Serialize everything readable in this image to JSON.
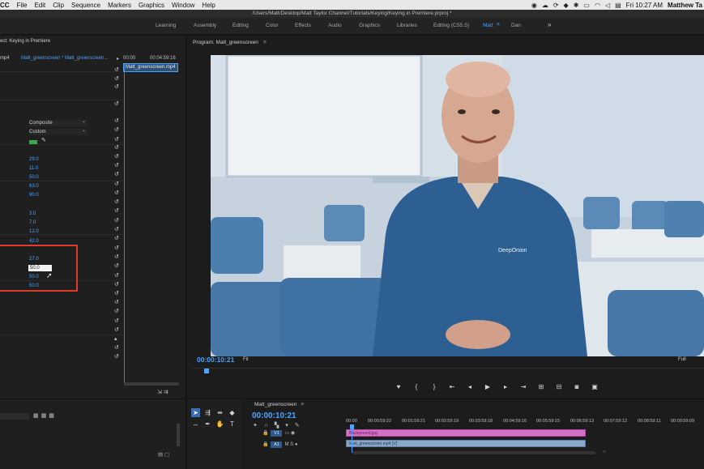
{
  "menubar": {
    "app": "CC",
    "items": [
      "File",
      "Edit",
      "Clip",
      "Sequence",
      "Markers",
      "Graphics",
      "Window",
      "Help"
    ],
    "clock": "Fri 10:27 AM",
    "user": "Matthew Ta"
  },
  "window": {
    "path": "/Users/Matt/Desktop/Matt Taylor Channel/Tutorials/Keying/Keying in Premiere.prproj *"
  },
  "workspaces": {
    "items": [
      "Learning",
      "Assembly",
      "Editing",
      "Color",
      "Effects",
      "Audio",
      "Graphics",
      "Libraries",
      "Editing (CS5.5)",
      "Matt",
      "Dan"
    ],
    "active": "Matt",
    "more": "»"
  },
  "effect_controls": {
    "title": "ect: Keying in Premiere",
    "format": "mp4",
    "clip_path": "Matt_greenscreen * Matt_greenscreen...",
    "start_time": "00:00",
    "end_time": "00:04:59:16",
    "clip_name": "Matt_greenscreen.mp4",
    "output_dropdown": "Composite",
    "settings_dropdown": "Custom",
    "values_group1": [
      "29.0",
      "11.0",
      "50.0",
      "63.0",
      "90.0"
    ],
    "values_group2": [
      "3.0",
      "7.0",
      "12.0",
      "42.0"
    ],
    "values_group3": [
      "27.0",
      "50.0",
      "50.0",
      "50.0"
    ]
  },
  "program": {
    "title": "Program: Matt_greenscreen",
    "timecode": "00:00:10:21",
    "fit": "Fit",
    "quality": "Full",
    "shirt_logo": "DeepOnion"
  },
  "timeline": {
    "title": "Matt_greenscreen",
    "timecode": "00:00:10:21",
    "ruler": [
      "00:00",
      "00:00:59:22",
      "00:01:59:21",
      "00:02:59:19",
      "00:03:59:18",
      "00:04:59:16",
      "00:05:59:15",
      "00:06:59:13",
      "00:07:59:12",
      "00:08:59:11",
      "00:09:59:09"
    ],
    "tracks": [
      "V1",
      "A1"
    ],
    "clip_v2": "Background.jpg",
    "clip_v1": "Matt_greenscreen.mp4 [V]"
  }
}
